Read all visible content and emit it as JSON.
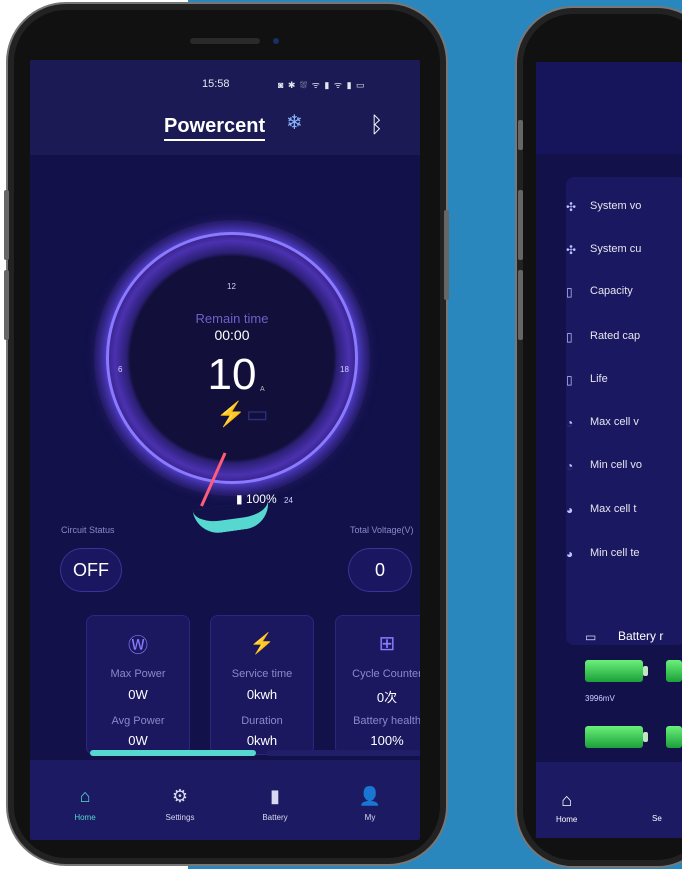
{
  "phone1": {
    "status": {
      "time": "15:58",
      "icons": "◙ ✱ ⛆ ᯤ ▮ ᯤ ▮ ▭"
    },
    "header": {
      "brand": "Powercent",
      "bluetooth_icon": "bluetooth-icon"
    },
    "dial": {
      "remain_label": "Remain time",
      "remain_time": "00:00",
      "value": "10",
      "unit": "A",
      "ticks": [
        "12",
        "6",
        "18",
        "24"
      ],
      "battery_percent": "100%"
    },
    "circuit": {
      "label": "Circuit Status",
      "value": "OFF"
    },
    "total_voltage": {
      "label": "Total Voltage(V)",
      "value": "0"
    },
    "cards": [
      {
        "icon": "watt-icon",
        "label1": "Max Power",
        "value1": "0W",
        "label2": "Avg Power",
        "value2": "0W"
      },
      {
        "icon": "service-time-icon",
        "label1": "Service time",
        "value1": "0kwh",
        "label2": "Duration",
        "value2": "0kwh"
      },
      {
        "icon": "battery-plus-icon",
        "label1": "Cycle Counter",
        "value1": "0次",
        "label2": "Battery health",
        "value2": "100%"
      }
    ],
    "tabs": [
      {
        "label": "Home",
        "icon": "home-icon"
      },
      {
        "label": "Settings",
        "icon": "gear-icon"
      },
      {
        "label": "Battery",
        "icon": "battery-icon"
      },
      {
        "label": "My",
        "icon": "user-icon"
      }
    ],
    "accent": "#56d8d0"
  },
  "phone2": {
    "rows": [
      {
        "label": "System vo",
        "icon": "fan-icon"
      },
      {
        "label": "System cu",
        "icon": "fan-icon"
      },
      {
        "label": "Capacity",
        "icon": "battery-icon"
      },
      {
        "label": "Rated cap",
        "icon": "battery-icon"
      },
      {
        "label": "Life",
        "icon": "battery-icon"
      },
      {
        "label": "Max cell v",
        "icon": "gauge-icon"
      },
      {
        "label": "Min cell vo",
        "icon": "gauge-icon"
      },
      {
        "label": "Max cell t",
        "icon": "thermometer-icon"
      },
      {
        "label": "Min cell te",
        "icon": "thermometer-icon"
      }
    ],
    "battery_title": "Battery r",
    "cell_mv": "3996mV",
    "tabs": {
      "home": "Home",
      "settings_partial": "Se"
    }
  }
}
